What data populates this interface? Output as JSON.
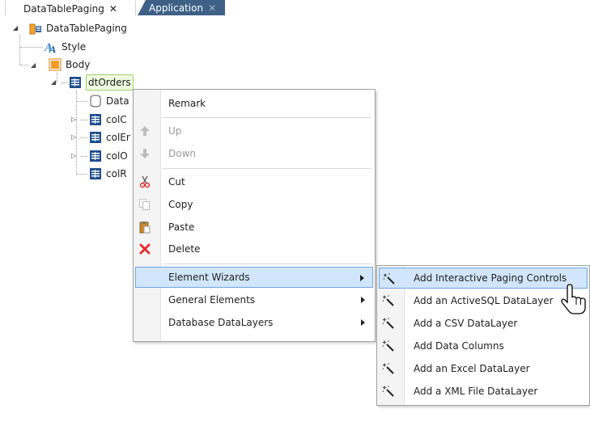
{
  "tabs": [
    {
      "label": "DataTablePaging",
      "close": "✕",
      "active": true
    },
    {
      "label": "Application",
      "close": "✕",
      "active": false
    }
  ],
  "tree": {
    "root": "DataTablePaging",
    "style": "Style",
    "body": "Body",
    "table": "dtOrders",
    "children": [
      "Data",
      "colC",
      "colEr",
      "colO",
      "colR"
    ]
  },
  "context_menu": {
    "items": [
      {
        "label": "Remark",
        "enabled": true
      },
      {
        "label": "Up",
        "enabled": false
      },
      {
        "label": "Down",
        "enabled": false
      },
      {
        "label": "Cut",
        "enabled": true
      },
      {
        "label": "Copy",
        "enabled": true
      },
      {
        "label": "Paste",
        "enabled": true
      },
      {
        "label": "Delete",
        "enabled": true
      },
      {
        "label": "Element Wizards",
        "enabled": true,
        "submenu": true,
        "highlighted": true
      },
      {
        "label": "General Elements",
        "enabled": true,
        "submenu": true
      },
      {
        "label": "Database DataLayers",
        "enabled": true,
        "submenu": true
      }
    ]
  },
  "submenu": {
    "items": [
      {
        "label": "Add Interactive Paging Controls",
        "highlighted": true
      },
      {
        "label": "Add an ActiveSQL DataLayer"
      },
      {
        "label": "Add a CSV DataLayer"
      },
      {
        "label": "Add Data Columns"
      },
      {
        "label": "Add an Excel DataLayer"
      },
      {
        "label": "Add a XML File DataLayer"
      }
    ]
  },
  "colors": {
    "highlight_bg": "#d2e6fb",
    "highlight_border": "#6aa4e6",
    "inactive_tab": "#3e5f86",
    "selection_border": "#9ed06a"
  }
}
